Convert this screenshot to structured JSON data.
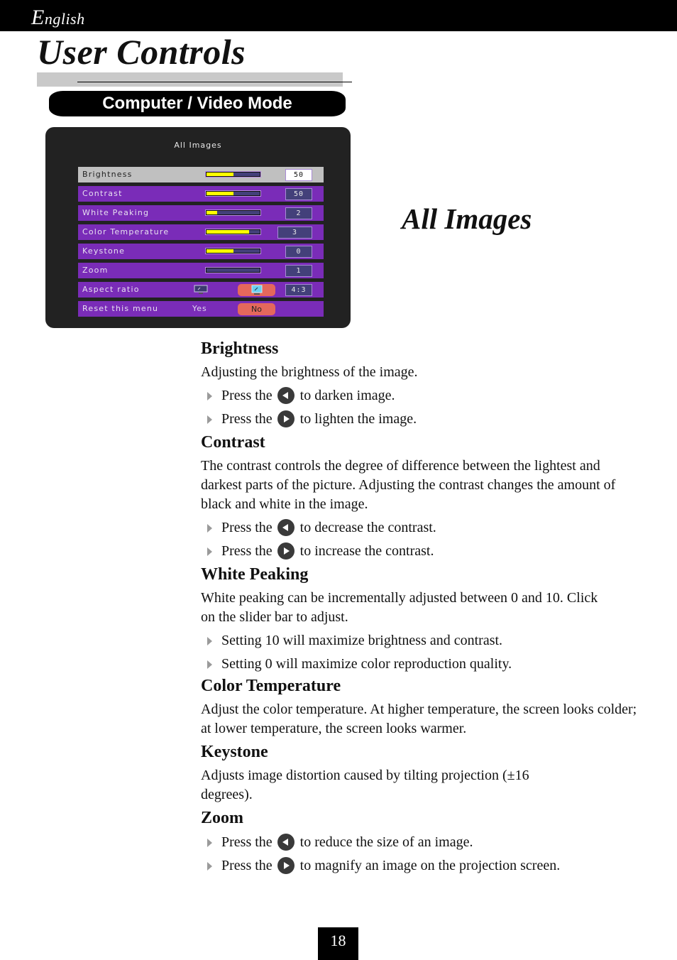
{
  "header": {
    "language_initial": "E",
    "language_rest": "nglish",
    "page_title": "User Controls",
    "mode_label": "Computer / Video Mode"
  },
  "osd": {
    "title": "All Images",
    "rows": [
      {
        "label": "Brightness",
        "type": "slider",
        "fill_fraction": 0.5,
        "value": "50",
        "selected": true
      },
      {
        "label": "Contrast",
        "type": "slider",
        "fill_fraction": 0.5,
        "value": "50",
        "selected": false
      },
      {
        "label": "White Peaking",
        "type": "slider",
        "fill_fraction": 0.2,
        "value": "2",
        "selected": false
      },
      {
        "label": "Color Temperature",
        "type": "slider",
        "fill_fraction": 0.8,
        "value": "3",
        "selected": false
      },
      {
        "label": "Keystone",
        "type": "slider",
        "fill_fraction": 0.5,
        "value": "0",
        "selected": false
      },
      {
        "label": "Zoom",
        "type": "slider",
        "fill_fraction": 0.0,
        "value": "1",
        "selected": false
      },
      {
        "label": "Aspect ratio",
        "type": "options",
        "options": [
          "wide-monitor-icon",
          "standard-monitor-icon"
        ],
        "active_option": 1,
        "value": "4:3"
      },
      {
        "label": "Reset this menu",
        "type": "yesno",
        "yes_label": "Yes",
        "no_label": "No",
        "active_option": "No"
      }
    ],
    "colors": {
      "background": "#222222",
      "row": "#7a2cb8",
      "row_selected": "#c0c0c0",
      "slider_fill": "#ffff00",
      "slider_track": "#43407a",
      "active_option": "#e4685c"
    }
  },
  "section_heading": "All Images",
  "sections": [
    {
      "title": "Brightness",
      "paragraphs": [
        "Adjusting the brightness of the image."
      ],
      "bullets": [
        {
          "pre": "Press the",
          "icon": "left-arrow-button-icon",
          "post": "to darken image."
        },
        {
          "pre": "Press the",
          "icon": "right-arrow-button-icon",
          "post": "to lighten the image."
        }
      ]
    },
    {
      "title": "Contrast",
      "paragraphs": [
        "The contrast controls the degree of difference between the lightest and darkest parts of the picture. Adjusting the contrast changes the amount of black and white in the image."
      ],
      "bullets": [
        {
          "pre": "Press the",
          "icon": "left-arrow-button-icon",
          "post": "to decrease the contrast."
        },
        {
          "pre": "Press the",
          "icon": "right-arrow-button-icon",
          "post": "to increase the contrast."
        }
      ]
    },
    {
      "title": "White Peaking",
      "paragraphs": [
        "White peaking can be incrementally adjusted between 0 and 10.  Click on the slider bar to adjust."
      ],
      "bullets": [
        {
          "text": "Setting 10 will maximize brightness and contrast."
        },
        {
          "text": "Setting 0 will maximize color reproduction quality."
        }
      ]
    },
    {
      "title": "Color Temperature",
      "paragraphs": [
        "Adjust the color temperature. At higher temperature, the screen looks colder; at lower temperature, the screen looks warmer."
      ],
      "bullets": []
    },
    {
      "title": "Keystone",
      "paragraphs": [
        "Adjusts image distortion caused by tilting projection (±16 degrees)."
      ],
      "bullets": []
    },
    {
      "title": "Zoom",
      "paragraphs": [],
      "bullets": [
        {
          "pre": "Press the",
          "icon": "left-arrow-button-icon",
          "post": "to reduce the size of an image."
        },
        {
          "pre": "Press the",
          "icon": "right-arrow-button-icon",
          "post": "to magnify an image on the projection screen."
        }
      ]
    }
  ],
  "footer": {
    "page_number": "18"
  }
}
